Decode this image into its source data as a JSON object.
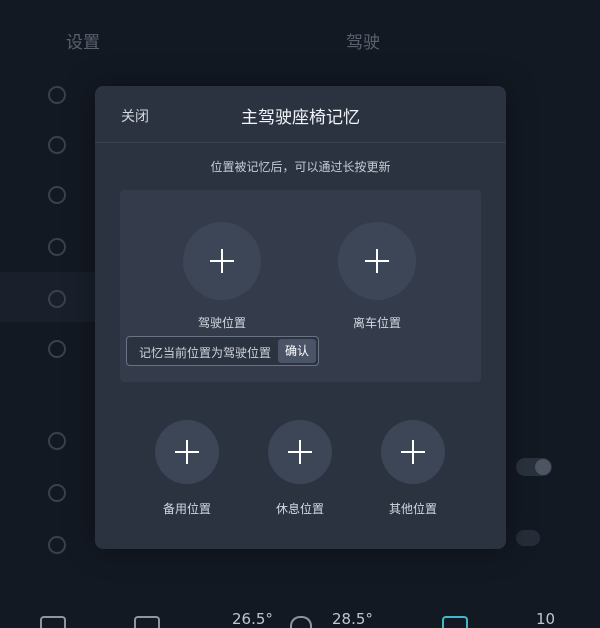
{
  "background": {
    "header_left": "设置",
    "header_center": "驾驶"
  },
  "modal": {
    "close_label": "关闭",
    "title": "主驾驶座椅记忆",
    "hint": "位置被记忆后，可以通过长按更新",
    "slots_top": [
      {
        "label": "驾驶位置"
      },
      {
        "label": "离车位置"
      }
    ],
    "tooltip": {
      "text": "记忆当前位置为驾驶位置",
      "confirm_label": "确认"
    },
    "slots_bottom": [
      {
        "label": "备用位置"
      },
      {
        "label": "休息位置"
      },
      {
        "label": "其他位置"
      }
    ]
  },
  "bottom_bar": {
    "temp_left": "26.5°",
    "temp_right": "28.5°",
    "right_value": "10"
  },
  "colors": {
    "modal_bg": "#2b3240",
    "panel_bg": "#343c4b",
    "circle_bg": "#3d4657"
  }
}
